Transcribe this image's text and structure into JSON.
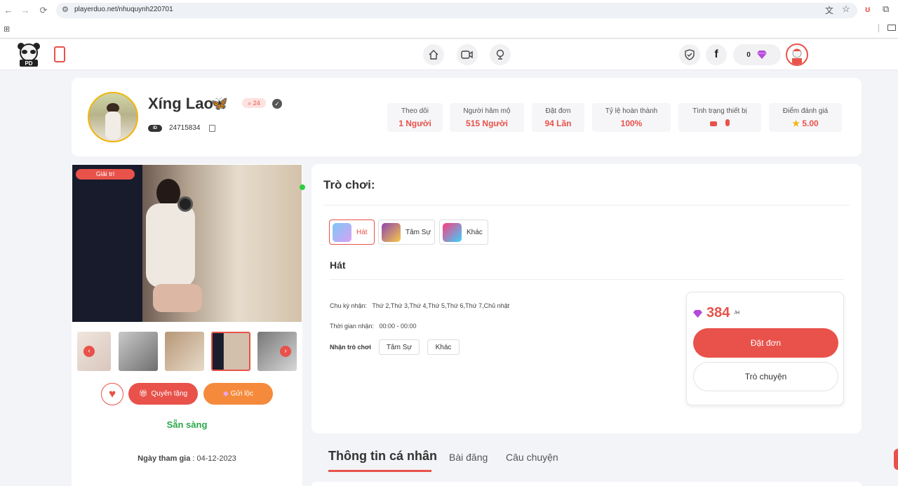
{
  "browser": {
    "url": "playerduo.net/nhuquynh220701"
  },
  "header": {
    "diamond_count": "0"
  },
  "profile": {
    "name": "Xíng Lao",
    "name_emoji": "🦋",
    "badge_count": "24",
    "id_label": "ID",
    "id_value": "24715834",
    "stats": [
      {
        "label": "Theo dõi",
        "value": "1 Người"
      },
      {
        "label": "Người hâm mộ",
        "value": "515 Người"
      },
      {
        "label": "Đặt đơn",
        "value": "94 Lần"
      },
      {
        "label": "Tỷ lệ hoàn thành",
        "value": "100%"
      },
      {
        "label": "Tình trạng thiết bị",
        "value": ""
      },
      {
        "label": "Điểm đánh giá",
        "value": "5.00"
      }
    ]
  },
  "gallery": {
    "category_badge": "Giải trí"
  },
  "actions": {
    "gift_label": "Quyên tặng",
    "send_label": "Gửi lộc"
  },
  "status": {
    "text": "Sẵn sàng",
    "join_label": "Ngày tham gia",
    "join_date": ": 04-12-2023"
  },
  "games": {
    "title": "Trò chơi:",
    "items": [
      {
        "label": "Hát"
      },
      {
        "label": "Tâm Sự"
      },
      {
        "label": "Khác"
      }
    ],
    "selected_title": "Hát",
    "cycle_label": "Chu kỳ nhận:",
    "cycle_value": "Thứ 2,Thứ 3,Thứ 4,Thứ 5,Thứ 6,Thứ 7,Chủ nhật",
    "time_label": "Thời gian nhận:",
    "time_value": "00:00 - 00:00",
    "tags_label": "Nhận trò chơi",
    "tags": [
      "Tâm Sự",
      "Khác"
    ]
  },
  "order": {
    "price": "384",
    "unit": "/H",
    "order_label": "Đặt đơn",
    "chat_label": "Trò chuyện"
  },
  "tabs": [
    {
      "label": "Thông tin cá nhân"
    },
    {
      "label": "Bài đăng"
    },
    {
      "label": "Câu chuyện"
    }
  ],
  "colors": {
    "accent": "#e8524a",
    "orange": "#f58a3c",
    "green": "#2ba84a",
    "gold": "#f2b50c",
    "diamond": "#b24bd9"
  }
}
